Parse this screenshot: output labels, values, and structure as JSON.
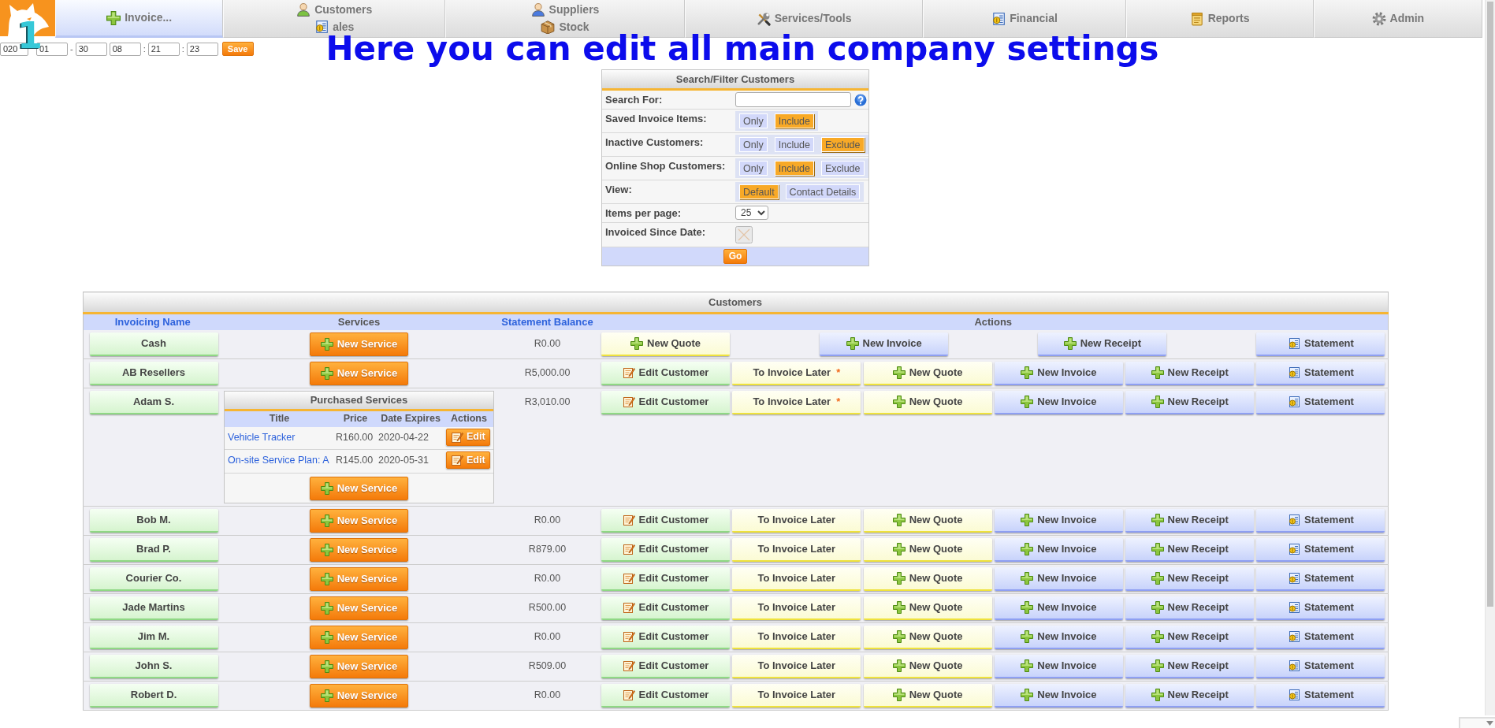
{
  "nav": {
    "tabs": [
      {
        "lines": [
          "Invoice..."
        ],
        "selected": true
      },
      {
        "lines": [
          "Customers",
          "ales"
        ],
        "selected": false
      },
      {
        "lines": [
          "Suppliers",
          "Stock"
        ],
        "selected": false
      },
      {
        "lines": [
          "Services/Tools"
        ],
        "selected": false
      },
      {
        "lines": [
          "Financial"
        ],
        "selected": false
      },
      {
        "lines": [
          "Reports"
        ],
        "selected": false
      },
      {
        "lines": [
          "Admin"
        ],
        "selected": false
      }
    ]
  },
  "overlay": {
    "step_number": "1",
    "heading": "Here you can edit all main company settings"
  },
  "datetime": {
    "parts": [
      {
        "kind": "input",
        "value": "020"
      },
      {
        "kind": "input",
        "value": "01"
      },
      {
        "kind": "separator",
        "text": "-"
      },
      {
        "kind": "input",
        "value": "30"
      },
      {
        "kind": "input",
        "value": "08"
      },
      {
        "kind": "separator",
        "text": ":"
      },
      {
        "kind": "input",
        "value": "21"
      },
      {
        "kind": "separator",
        "text": ":"
      },
      {
        "kind": "input",
        "value": "23"
      }
    ],
    "save_button": "Save"
  },
  "filter": {
    "title": "Search/Filter Customers",
    "rows": [
      {
        "kind": "search",
        "label": "Search For:"
      },
      {
        "kind": "toggle",
        "label": "Saved Invoice Items:",
        "options": [
          {
            "label": "Only",
            "selected": false
          },
          {
            "label": "Include",
            "selected": true
          }
        ]
      },
      {
        "kind": "toggle",
        "label": "Inactive Customers:",
        "options": [
          {
            "label": "Only",
            "selected": false
          },
          {
            "label": "Include",
            "selected": false
          },
          {
            "label": "Exclude",
            "selected": true
          }
        ]
      },
      {
        "kind": "toggle",
        "label": "Online Shop Customers:",
        "options": [
          {
            "label": "Only",
            "selected": false
          },
          {
            "label": "Include",
            "selected": true
          },
          {
            "label": "Exclude",
            "selected": false
          }
        ]
      },
      {
        "kind": "toggle",
        "label": "View:",
        "options": [
          {
            "label": "Default",
            "selected": true
          },
          {
            "label": "Contact Details",
            "selected": false
          }
        ]
      },
      {
        "kind": "select",
        "label": "Items per page:",
        "value": "25"
      },
      {
        "kind": "date",
        "label": "Invoiced Since Date:"
      }
    ],
    "go_button": "Go"
  },
  "customers": {
    "title": "Customers",
    "columns": [
      {
        "label": "Invoicing Name",
        "sortable": true
      },
      {
        "label": "Services",
        "sortable": false
      },
      {
        "label": "Statement Balance",
        "sortable": true
      },
      {
        "label": "Actions",
        "sortable": false
      }
    ],
    "rows": [
      {
        "name": "Cash",
        "service_button": "New Service",
        "balance": "R0.00",
        "actions": [
          {
            "kind": "quote",
            "label": "New Quote"
          },
          {
            "kind": "invoice",
            "label": "New Invoice"
          },
          {
            "kind": "receipt",
            "label": "New Receipt"
          },
          {
            "kind": "statement",
            "label": "Statement"
          }
        ]
      },
      {
        "name": "AB Resellers",
        "service_button": "New Service",
        "balance": "R5,000.00",
        "actions": [
          {
            "kind": "edit",
            "label": "Edit Customer"
          },
          {
            "kind": "later",
            "label": "To Invoice Later",
            "asterisk": "*"
          },
          {
            "kind": "quote",
            "label": "New Quote"
          },
          {
            "kind": "invoice",
            "label": "New Invoice"
          },
          {
            "kind": "receipt",
            "label": "New Receipt"
          },
          {
            "kind": "statement",
            "label": "Statement"
          }
        ]
      },
      {
        "name": "Adam S.",
        "purchased_services": {
          "title": "Purchased Services",
          "columns": [
            "Title",
            "Price",
            "Date Expires",
            "Actions"
          ],
          "rows": [
            {
              "title": "Vehicle Tracker",
              "price": "R160.00",
              "expires": "2020-04-22",
              "edit_button": "Edit"
            },
            {
              "title": "On-site Service Plan: A",
              "price": "R145.00",
              "expires": "2020-05-31",
              "edit_button": "Edit"
            }
          ]
        },
        "service_button": "New Service",
        "balance": "R3,010.00",
        "actions": [
          {
            "kind": "edit",
            "label": "Edit Customer"
          },
          {
            "kind": "later",
            "label": "To Invoice Later",
            "asterisk": "*"
          },
          {
            "kind": "quote",
            "label": "New Quote"
          },
          {
            "kind": "invoice",
            "label": "New Invoice"
          },
          {
            "kind": "receipt",
            "label": "New Receipt"
          },
          {
            "kind": "statement",
            "label": "Statement"
          }
        ]
      },
      {
        "name": "Bob M.",
        "service_button": "New Service",
        "balance": "R0.00",
        "actions": [
          {
            "kind": "edit",
            "label": "Edit Customer"
          },
          {
            "kind": "later",
            "label": "To Invoice Later"
          },
          {
            "kind": "quote",
            "label": "New Quote"
          },
          {
            "kind": "invoice",
            "label": "New Invoice"
          },
          {
            "kind": "receipt",
            "label": "New Receipt"
          },
          {
            "kind": "statement",
            "label": "Statement"
          }
        ]
      },
      {
        "name": "Brad P.",
        "service_button": "New Service",
        "balance": "R879.00",
        "actions": [
          {
            "kind": "edit",
            "label": "Edit Customer"
          },
          {
            "kind": "later",
            "label": "To Invoice Later"
          },
          {
            "kind": "quote",
            "label": "New Quote"
          },
          {
            "kind": "invoice",
            "label": "New Invoice"
          },
          {
            "kind": "receipt",
            "label": "New Receipt"
          },
          {
            "kind": "statement",
            "label": "Statement"
          }
        ]
      },
      {
        "name": "Courier Co.",
        "service_button": "New Service",
        "balance": "R0.00",
        "actions": [
          {
            "kind": "edit",
            "label": "Edit Customer"
          },
          {
            "kind": "later",
            "label": "To Invoice Later"
          },
          {
            "kind": "quote",
            "label": "New Quote"
          },
          {
            "kind": "invoice",
            "label": "New Invoice"
          },
          {
            "kind": "receipt",
            "label": "New Receipt"
          },
          {
            "kind": "statement",
            "label": "Statement"
          }
        ]
      },
      {
        "name": "Jade Martins",
        "service_button": "New Service",
        "balance": "R500.00",
        "actions": [
          {
            "kind": "edit",
            "label": "Edit Customer"
          },
          {
            "kind": "later",
            "label": "To Invoice Later"
          },
          {
            "kind": "quote",
            "label": "New Quote"
          },
          {
            "kind": "invoice",
            "label": "New Invoice"
          },
          {
            "kind": "receipt",
            "label": "New Receipt"
          },
          {
            "kind": "statement",
            "label": "Statement"
          }
        ]
      },
      {
        "name": "Jim M.",
        "service_button": "New Service",
        "balance": "R0.00",
        "actions": [
          {
            "kind": "edit",
            "label": "Edit Customer"
          },
          {
            "kind": "later",
            "label": "To Invoice Later"
          },
          {
            "kind": "quote",
            "label": "New Quote"
          },
          {
            "kind": "invoice",
            "label": "New Invoice"
          },
          {
            "kind": "receipt",
            "label": "New Receipt"
          },
          {
            "kind": "statement",
            "label": "Statement"
          }
        ]
      },
      {
        "name": "John S.",
        "service_button": "New Service",
        "balance": "R509.00",
        "actions": [
          {
            "kind": "edit",
            "label": "Edit Customer"
          },
          {
            "kind": "later",
            "label": "To Invoice Later"
          },
          {
            "kind": "quote",
            "label": "New Quote"
          },
          {
            "kind": "invoice",
            "label": "New Invoice"
          },
          {
            "kind": "receipt",
            "label": "New Receipt"
          },
          {
            "kind": "statement",
            "label": "Statement"
          }
        ]
      },
      {
        "name": "Robert D.",
        "service_button": "New Service",
        "balance": "R0.00",
        "actions": [
          {
            "kind": "edit",
            "label": "Edit Customer"
          },
          {
            "kind": "later",
            "label": "To Invoice Later"
          },
          {
            "kind": "quote",
            "label": "New Quote"
          },
          {
            "kind": "invoice",
            "label": "New Invoice"
          },
          {
            "kind": "receipt",
            "label": "New Receipt"
          },
          {
            "kind": "statement",
            "label": "Statement"
          }
        ]
      }
    ]
  }
}
